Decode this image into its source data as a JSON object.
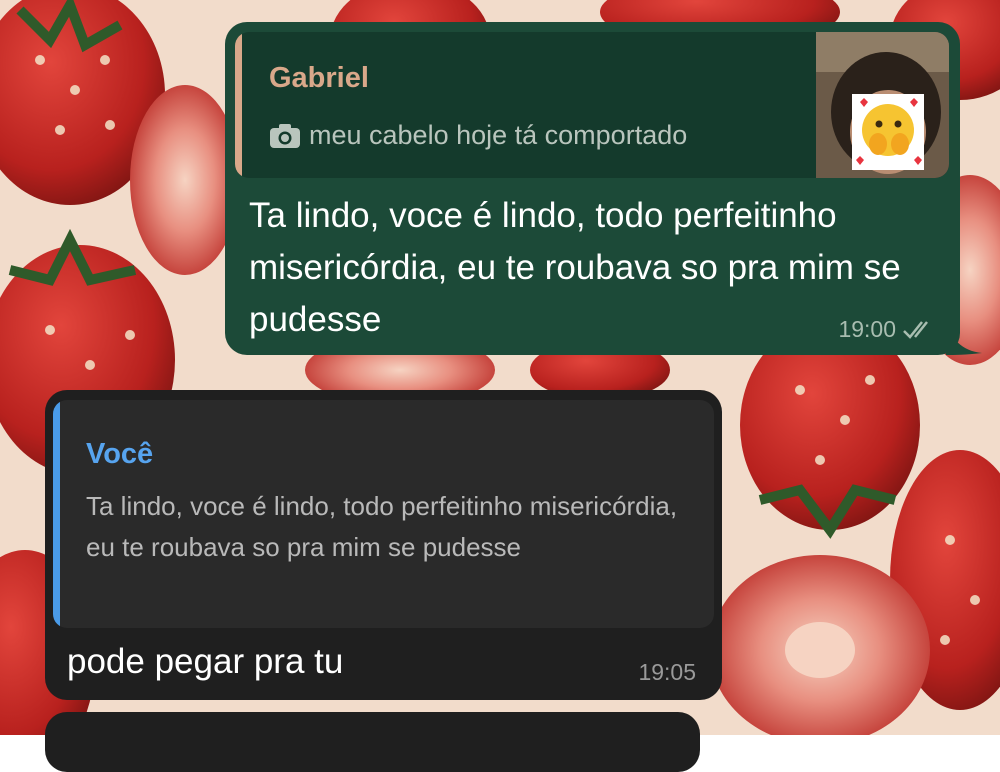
{
  "outgoing_message": {
    "quote": {
      "author": "Gabriel",
      "caption": "meu cabelo hoje tá comportado"
    },
    "text": "Ta lindo, voce é lindo, todo perfeitinho misericórdia, eu te roubava so pra mim se pudesse",
    "time": "19:00",
    "status_icon": "double-check-icon"
  },
  "incoming_message": {
    "quote": {
      "author": "Você",
      "text": "Ta lindo, voce é lindo, todo perfeitinho misericórdia, eu te roubava so pra mim se pudesse"
    },
    "text": "pode pegar pra tu",
    "time": "19:05"
  },
  "colors": {
    "outgoing_bubble": "#1c4a38",
    "incoming_bubble": "#1f1f1f",
    "quote_author_outgoing": "#d9a88a",
    "quote_author_incoming": "#57a4ef",
    "wallpaper_base": "#f2dccb"
  }
}
